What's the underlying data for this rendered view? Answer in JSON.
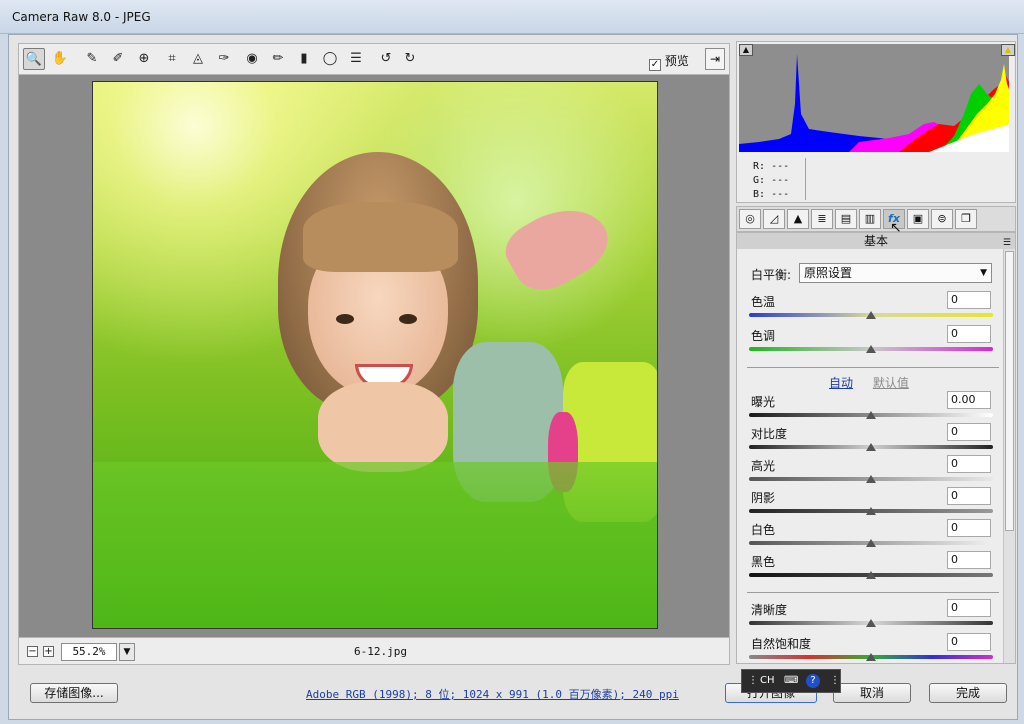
{
  "window": {
    "title": "Camera Raw 8.0 -  JPEG"
  },
  "toolbar": {
    "tools": [
      {
        "name": "zoom-tool",
        "icon": "magnifier-icon",
        "glyph": "🔍"
      },
      {
        "name": "hand-tool",
        "icon": "hand-icon",
        "glyph": "✋"
      },
      {
        "name": "white-balance-tool",
        "icon": "eyedropper-icon",
        "glyph": "✎"
      },
      {
        "name": "color-sampler-tool",
        "icon": "color-sampler-icon",
        "glyph": "✐"
      },
      {
        "name": "targeted-adjustment-tool",
        "icon": "target-icon",
        "glyph": "⊕"
      },
      {
        "name": "crop-tool",
        "icon": "crop-icon",
        "glyph": "⌗"
      },
      {
        "name": "straighten-tool",
        "icon": "straighten-icon",
        "glyph": "◬"
      },
      {
        "name": "spot-removal-tool",
        "icon": "spot-removal-icon",
        "glyph": "✑"
      },
      {
        "name": "red-eye-tool",
        "icon": "red-eye-icon",
        "glyph": "◉"
      },
      {
        "name": "adjustment-brush-tool",
        "icon": "brush-icon",
        "glyph": "✏"
      },
      {
        "name": "graduated-filter-tool",
        "icon": "graduated-filter-icon",
        "glyph": "▮"
      },
      {
        "name": "radial-filter-tool",
        "icon": "radial-filter-icon",
        "glyph": "◯"
      },
      {
        "name": "preferences-tool",
        "icon": "list-icon",
        "glyph": "☰"
      },
      {
        "name": "rotate-left-tool",
        "icon": "rotate-left-icon",
        "glyph": "↺"
      },
      {
        "name": "rotate-right-tool",
        "icon": "rotate-right-icon",
        "glyph": "↻"
      }
    ],
    "preview_label": "预览",
    "preview_checked": "✓",
    "fullscreen_glyph": "⇥"
  },
  "status": {
    "zoom_value": "55.2%",
    "zoom_out": "−",
    "zoom_in": "+",
    "dropdown_glyph": "▼",
    "filename": "6-12.jpg"
  },
  "histogram": {
    "r_label": "R:",
    "r_value": "---",
    "g_label": "G:",
    "g_value": "---",
    "b_label": "B:",
    "b_value": "---",
    "clip_left_glyph": "▲",
    "clip_right_glyph": "▲"
  },
  "panel_tabs": [
    {
      "name": "tab-basic",
      "icon": "aperture-icon",
      "glyph": "◎"
    },
    {
      "name": "tab-tone-curve",
      "icon": "curve-icon",
      "glyph": "◿"
    },
    {
      "name": "tab-detail",
      "icon": "detail-icon",
      "glyph": "▲"
    },
    {
      "name": "tab-hsl",
      "icon": "hsl-icon",
      "glyph": "≣"
    },
    {
      "name": "tab-split-toning",
      "icon": "split-toning-icon",
      "glyph": "▤"
    },
    {
      "name": "tab-lens-corrections",
      "icon": "lens-icon",
      "glyph": "▥"
    },
    {
      "name": "tab-effects",
      "icon": "fx-icon",
      "glyph": "fx"
    },
    {
      "name": "tab-camera-calibration",
      "icon": "camera-icon",
      "glyph": "▣"
    },
    {
      "name": "tab-presets",
      "icon": "presets-icon",
      "glyph": "⊜"
    },
    {
      "name": "tab-snapshots",
      "icon": "snapshots-icon",
      "glyph": "❐"
    }
  ],
  "panel": {
    "title": "基本",
    "menu_glyph": "☰",
    "white_balance_label": "白平衡:",
    "white_balance_value": "原照设置",
    "dropdown_glyph": "▼",
    "auto_label": "自动",
    "default_label": "默认值",
    "sliders": [
      {
        "name": "temperature",
        "label": "色温",
        "value": "0",
        "position": 0.5
      },
      {
        "name": "tint",
        "label": "色调",
        "value": "0",
        "position": 0.5
      },
      {
        "name": "exposure",
        "label": "曝光",
        "value": "0.00",
        "position": 0.5
      },
      {
        "name": "contrast",
        "label": "对比度",
        "value": "0",
        "position": 0.5
      },
      {
        "name": "highlights",
        "label": "高光",
        "value": "0",
        "position": 0.5
      },
      {
        "name": "shadows",
        "label": "阴影",
        "value": "0",
        "position": 0.5
      },
      {
        "name": "whites",
        "label": "白色",
        "value": "0",
        "position": 0.5
      },
      {
        "name": "blacks",
        "label": "黑色",
        "value": "0",
        "position": 0.5
      },
      {
        "name": "clarity",
        "label": "清晰度",
        "value": "0",
        "position": 0.5
      },
      {
        "name": "vibrance",
        "label": "自然饱和度",
        "value": "0",
        "position": 0.5
      }
    ]
  },
  "footer": {
    "save_label": "存储图像...",
    "info_link": "Adobe RGB (1998); 8 位; 1024 x 991 (1.0 百万像素); 240 ppi",
    "open_label": "打开图像",
    "cancel_label": "取消",
    "done_label": "完成"
  },
  "ime": {
    "lang": "CH",
    "help": "?"
  },
  "colors": {
    "accent_link": "#1d3da0",
    "panel_bg": "#ededed",
    "canvas_bg": "#8a8a8a"
  }
}
